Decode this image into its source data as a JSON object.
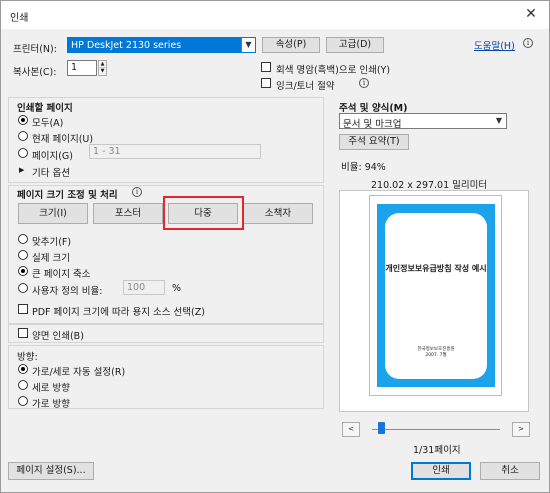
{
  "window": {
    "title": "인쇄",
    "close_icon": "close-icon"
  },
  "printer": {
    "label": "프린터(N):",
    "selected": "HP DeskJet 2130 series",
    "properties_btn": "속성(P)",
    "advanced_btn": "고급(D)",
    "help_link": "도움말(H)"
  },
  "copies": {
    "label": "복사본(C):",
    "value": "1",
    "grayscale_label": "회색 명암(흑백)으로 인쇄(Y)",
    "grayscale_checked": false,
    "save_ink_label": "잉크/토너 절약",
    "save_ink_checked": false
  },
  "pages_to_print": {
    "title": "인쇄할 페이지",
    "all": "모두(A)",
    "current": "현재 페이지(U)",
    "pages": "페이지(G)",
    "pages_range": "1 - 31",
    "more_options": "기타 옵션",
    "selected": "all"
  },
  "sizing": {
    "title": "페이지 크기 조정 및 처리",
    "tabs": [
      "크기(I)",
      "포스터",
      "다중",
      "소책자"
    ],
    "active_tab": "다중",
    "fit": "맞추기(F)",
    "actual": "실제 크기",
    "shrink": "큰 페이지 축소",
    "custom": "사용자 정의 비율:",
    "custom_value": "100",
    "custom_unit": "%",
    "choose_source": "PDF 페이지 크기에 따라 용지 소스 선택(Z)",
    "selected": "shrink",
    "choose_source_checked": false
  },
  "duplex": {
    "label": "양면 인쇄(B)",
    "checked": false
  },
  "orientation": {
    "title": "방향:",
    "auto": "가로/세로 자동 설정(R)",
    "portrait": "세로 방향",
    "landscape": "가로 방향",
    "selected": "auto"
  },
  "comments": {
    "title": "주석 및 양식(M)",
    "selected": "문서 및 마크업",
    "summary_btn": "주석 요약(T)"
  },
  "preview": {
    "scale": "비율: 94%",
    "dimensions": "210.02 x 297.01 밀리미터",
    "doc_title": "개인정보보유급방침 작성 예시",
    "doc_org": "한국정보보호진흥원",
    "doc_date": "2007. 7월",
    "page_counter": "1/31페이지",
    "prev": "<",
    "next": ">",
    "current_page": 1,
    "total_pages": 31,
    "page_color": "#1ba2ea"
  },
  "footer": {
    "page_setup_btn": "페이지 설정(S)...",
    "print_btn": "인쇄",
    "cancel_btn": "취소"
  }
}
